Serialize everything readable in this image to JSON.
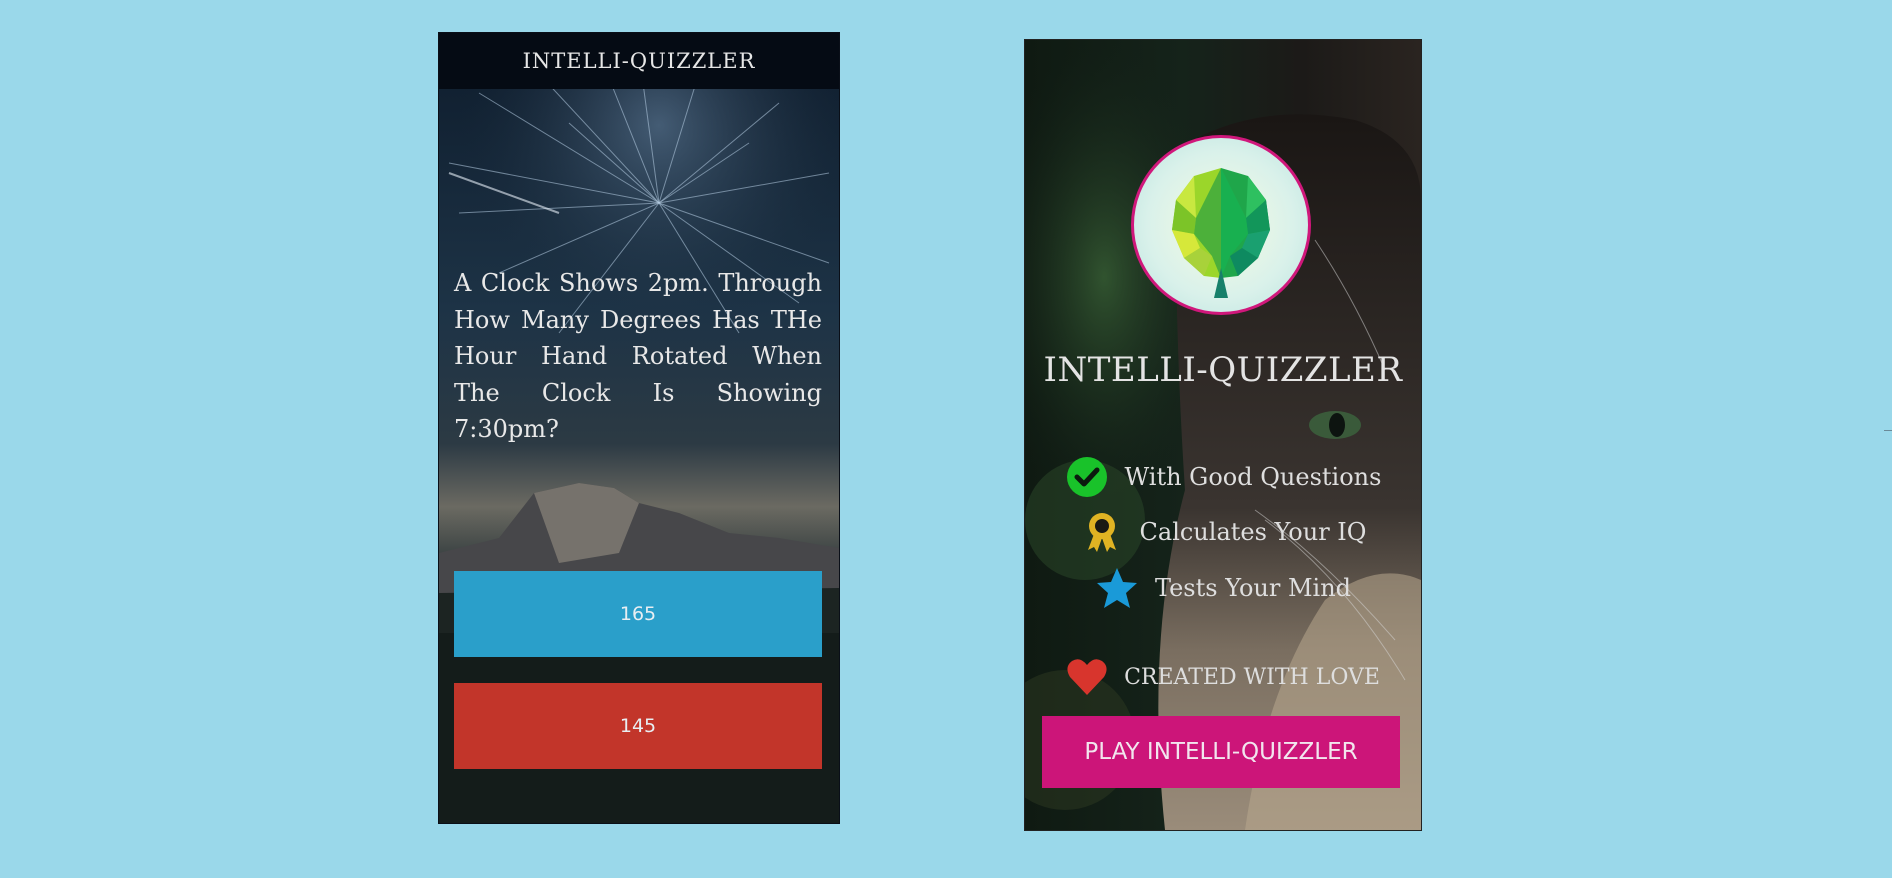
{
  "quiz_screen": {
    "header_title": "INTELLI-QUIZZLER",
    "question": "A Clock Shows 2pm. Through How Many Degrees Has THe Hour Hand Rotated When The Clock Is Showing 7:30pm?",
    "answers": [
      {
        "label": "165",
        "color": "#2a9fca"
      },
      {
        "label": "145",
        "color": "#c2352a"
      }
    ],
    "background": "starfield-mountain-image"
  },
  "landing_screen": {
    "logo": "brain-logo-icon",
    "title": "INTELLI-QUIZZLER",
    "features": [
      {
        "icon": "check-circle-icon",
        "text": "With Good Questions",
        "color": "#19c22a"
      },
      {
        "icon": "award-ribbon-icon",
        "text": "Calculates Your IQ",
        "color": "#e0b323"
      },
      {
        "icon": "star-icon",
        "text": "Tests Your Mind",
        "color": "#1a9ad8"
      }
    ],
    "love": {
      "icon": "heart-icon",
      "text": "CREATED WITH LOVE",
      "color": "#d8352d"
    },
    "play_button": "PLAY INTELLI-QUIZZLER",
    "play_button_color": "#cc1579",
    "background": "cat-photo-image"
  },
  "page_background": "#9ad8ea"
}
